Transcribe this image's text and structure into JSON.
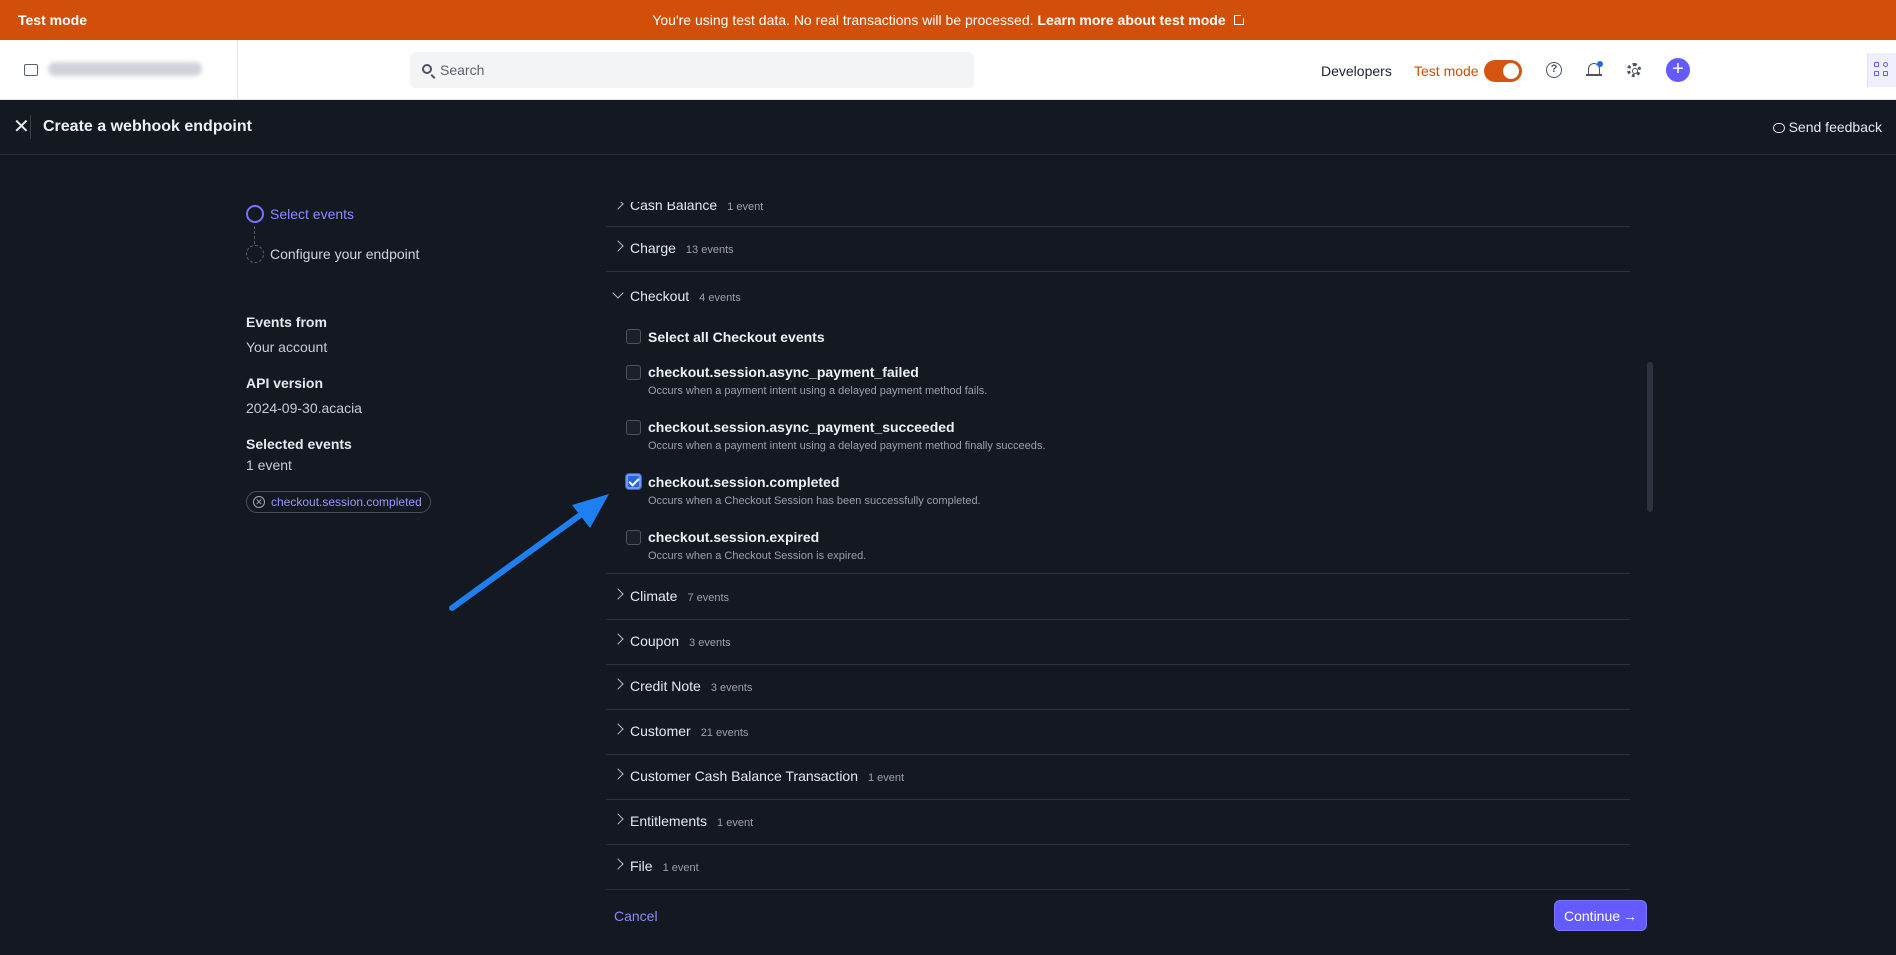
{
  "banner": {
    "mode": "Test mode",
    "message": "You're using test data. No real transactions will be processed.",
    "link": "Learn more about test mode"
  },
  "topnav": {
    "search_placeholder": "Search",
    "developers": "Developers",
    "test_mode": "Test mode",
    "test_mode_on": true
  },
  "header": {
    "title": "Create a webhook endpoint",
    "feedback": "Send feedback"
  },
  "steps": [
    {
      "label": "Select events",
      "active": true
    },
    {
      "label": "Configure your endpoint",
      "active": false
    }
  ],
  "summary": {
    "events_from_label": "Events from",
    "events_from_value": "Your account",
    "api_version_label": "API version",
    "api_version_value": "2024-09-30.acacia",
    "selected_label": "Selected events",
    "selected_count": "1 event",
    "selected_items": [
      "checkout.session.completed"
    ]
  },
  "categories_above": [
    {
      "name": "Cash Balance",
      "count": "1 event"
    },
    {
      "name": "Charge",
      "count": "13 events"
    }
  ],
  "checkout": {
    "name": "Checkout",
    "count": "4 events",
    "select_all": "Select all Checkout events",
    "events": [
      {
        "name": "checkout.session.async_payment_failed",
        "desc": "Occurs when a payment intent using a delayed payment method fails.",
        "checked": false
      },
      {
        "name": "checkout.session.async_payment_succeeded",
        "desc": "Occurs when a payment intent using a delayed payment method finally succeeds.",
        "checked": false
      },
      {
        "name": "checkout.session.completed",
        "desc": "Occurs when a Checkout Session has been successfully completed.",
        "checked": true
      },
      {
        "name": "checkout.session.expired",
        "desc": "Occurs when a Checkout Session is expired.",
        "checked": false
      }
    ]
  },
  "categories_below": [
    {
      "name": "Climate",
      "count": "7 events"
    },
    {
      "name": "Coupon",
      "count": "3 events"
    },
    {
      "name": "Credit Note",
      "count": "3 events"
    },
    {
      "name": "Customer",
      "count": "21 events"
    },
    {
      "name": "Customer Cash Balance Transaction",
      "count": "1 event"
    },
    {
      "name": "Entitlements",
      "count": "1 event"
    },
    {
      "name": "File",
      "count": "1 event"
    }
  ],
  "footer": {
    "cancel": "Cancel",
    "continue": "Continue"
  },
  "colors": {
    "banner": "#d14f08",
    "accent": "#635bff",
    "annotation_arrow": "#1e7ff0",
    "background": "#141820"
  }
}
